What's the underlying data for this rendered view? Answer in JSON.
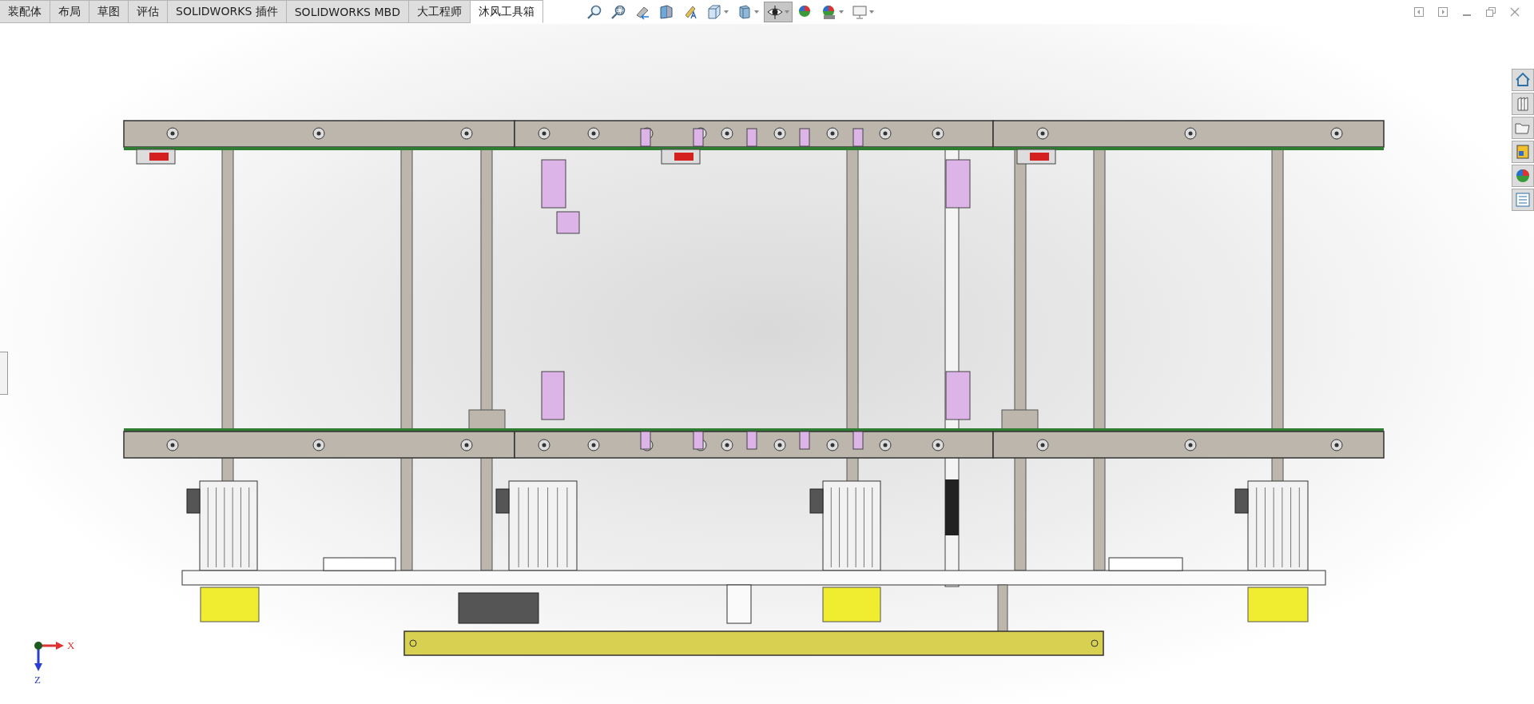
{
  "command_manager_tabs": [
    {
      "label": "装配体",
      "selected": false
    },
    {
      "label": "布局",
      "selected": false
    },
    {
      "label": "草图",
      "selected": false
    },
    {
      "label": "评估",
      "selected": false
    },
    {
      "label": "SOLIDWORKS 插件",
      "selected": false
    },
    {
      "label": "SOLIDWORKS MBD",
      "selected": false
    },
    {
      "label": "大工程师",
      "selected": false
    },
    {
      "label": "沐风工具箱",
      "selected": true
    }
  ],
  "heads_up_toolbar": [
    {
      "kind": "zoom-fit",
      "selected": false,
      "dropdown": false
    },
    {
      "kind": "zoom-area",
      "selected": false,
      "dropdown": false
    },
    {
      "kind": "previous-view",
      "selected": false,
      "dropdown": false
    },
    {
      "kind": "section-view",
      "selected": false,
      "dropdown": false
    },
    {
      "kind": "annotation",
      "selected": false,
      "dropdown": false
    },
    {
      "kind": "view-orientation",
      "selected": false,
      "dropdown": true
    },
    {
      "kind": "display-style",
      "selected": false,
      "dropdown": true
    },
    {
      "kind": "hide-show",
      "selected": true,
      "dropdown": true
    },
    {
      "kind": "appearance",
      "selected": false,
      "dropdown": false
    },
    {
      "kind": "scene",
      "selected": false,
      "dropdown": true
    },
    {
      "kind": "monitor",
      "selected": false,
      "dropdown": true
    }
  ],
  "triad": {
    "x_label": "X",
    "z_label": "Z"
  }
}
